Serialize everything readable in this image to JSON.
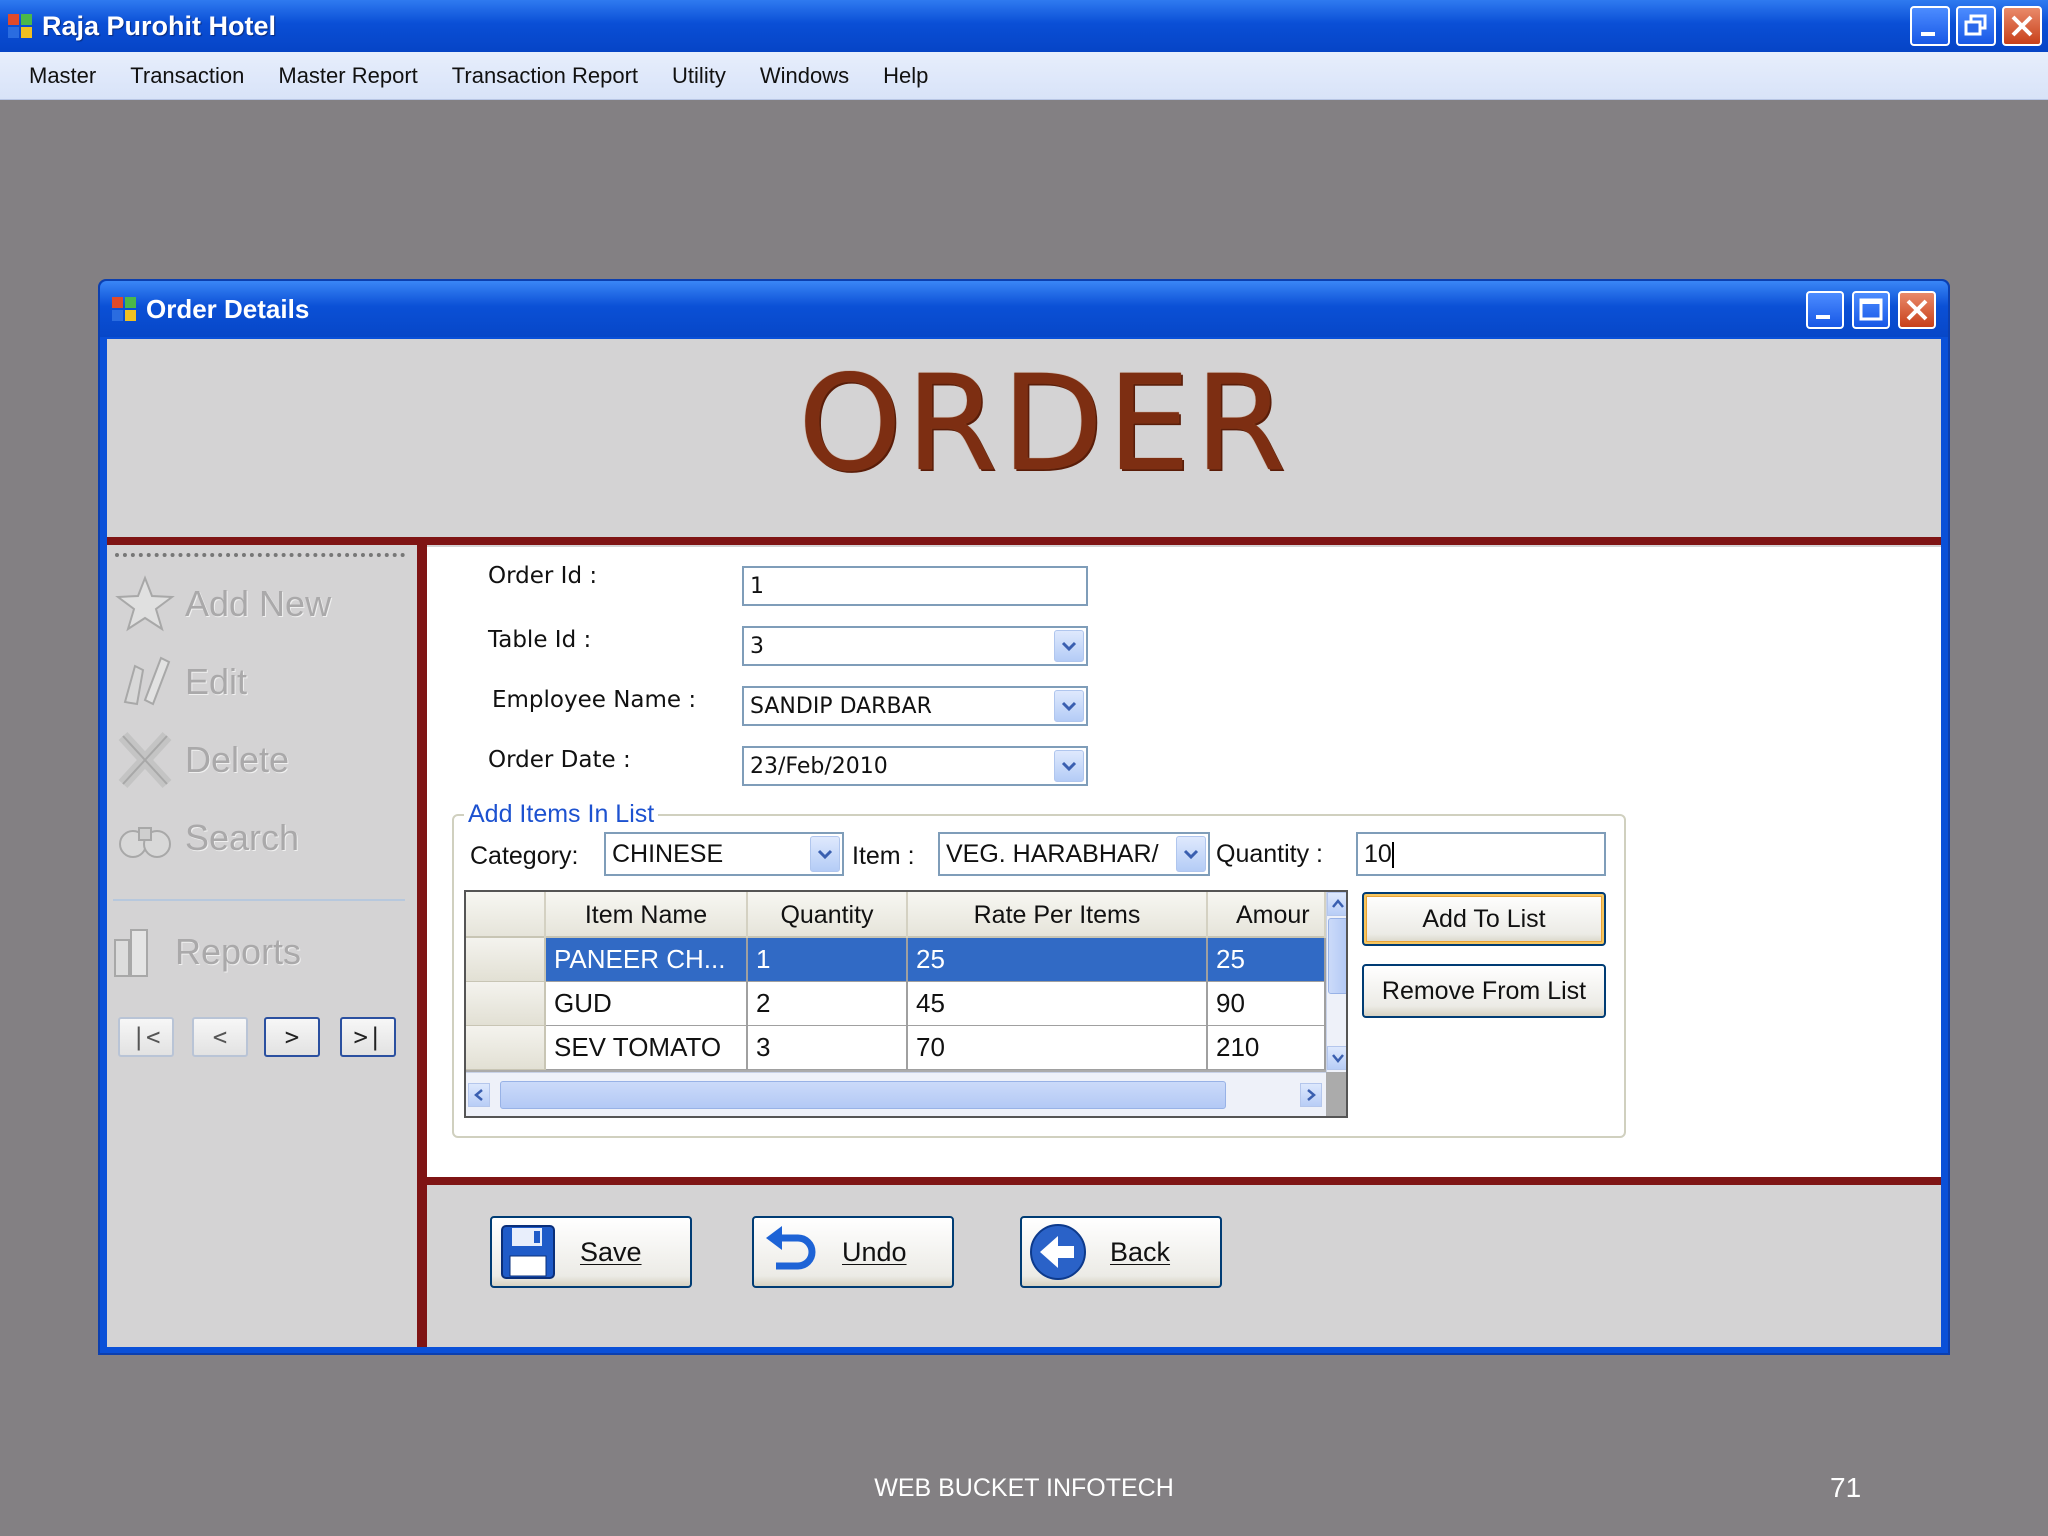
{
  "app": {
    "title": "Raja Purohit Hotel"
  },
  "menu": [
    "Master",
    "Transaction",
    "Master Report",
    "Transaction Report",
    "Utility",
    "Windows",
    "Help"
  ],
  "dialog": {
    "title": "Order Details",
    "heading": "ORDER"
  },
  "nav": {
    "items": [
      {
        "label": "Add New",
        "icon": "star-icon"
      },
      {
        "label": "Edit",
        "icon": "edit-icon"
      },
      {
        "label": "Delete",
        "icon": "delete-x-icon"
      },
      {
        "label": "Search",
        "icon": "binoculars-icon"
      },
      {
        "label": "Reports",
        "icon": "reports-icon"
      }
    ],
    "pager": [
      "|<",
      "<",
      ">",
      ">|"
    ]
  },
  "form": {
    "order_id": {
      "label": "Order Id :",
      "value": "1"
    },
    "table_id": {
      "label": "Table Id :",
      "value": "3"
    },
    "employee_name": {
      "label": "Employee  Name :",
      "value": "SANDIP DARBAR"
    },
    "order_date": {
      "label": "Order Date :",
      "value": "23/Feb/2010"
    }
  },
  "add_items": {
    "legend": "Add Items In List",
    "category_label": "Category:",
    "category_value": "CHINESE",
    "item_label": "Item :",
    "item_value": "VEG. HARABHAR/",
    "quantity_label": "Quantity :",
    "quantity_value": "10",
    "add_button": "Add To List",
    "remove_button": "Remove From List"
  },
  "grid": {
    "columns": [
      "Item Name",
      "Quantity",
      "Rate Per Items",
      "Amour"
    ],
    "rows": [
      [
        "PANEER CH...",
        "1",
        "25",
        "25"
      ],
      [
        "GUD",
        "2",
        "45",
        "90"
      ],
      [
        "SEV TOMATO",
        "3",
        "70",
        "210"
      ]
    ],
    "selected_row": 0
  },
  "actions": {
    "save": "Save",
    "undo": "Undo",
    "back": "Back"
  },
  "footer": {
    "company": "WEB BUCKET INFOTECH",
    "page": "71"
  },
  "colors": {
    "titlebar": "#0a50d8",
    "heading": "#7d2e12",
    "divider": "#7f1414",
    "selection": "#316ac5"
  }
}
